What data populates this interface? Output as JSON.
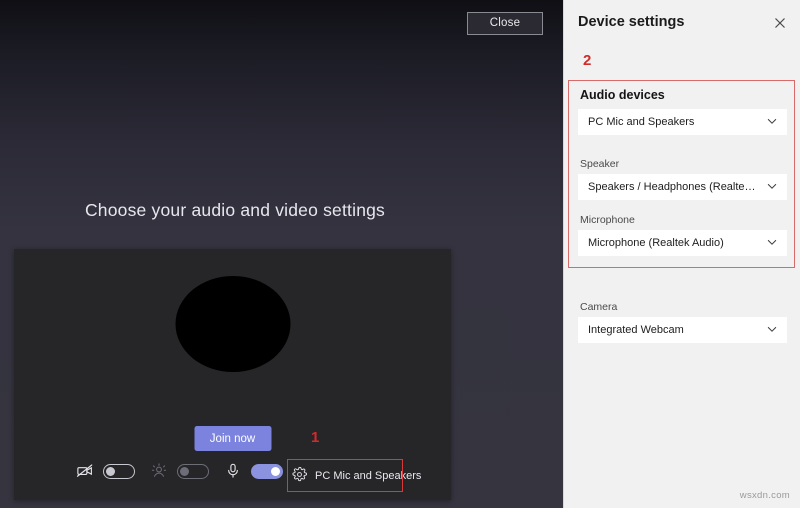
{
  "main": {
    "close_button_label": "Close",
    "heading": "Choose your audio and video settings",
    "join_button_label": "Join now",
    "device_chip_label": "PC Mic and Speakers",
    "controls": {
      "camera_icon": "camera-off-icon",
      "camera_toggle_state": "off",
      "background_blur_icon": "background-blur-icon",
      "background_blur_toggle_state": "off",
      "mic_icon": "microphone-icon",
      "mic_toggle_state": "on",
      "settings_icon": "gear-icon"
    }
  },
  "annotations": [
    {
      "label": "1",
      "target": "device-settings-chip",
      "color": "#d12b2b"
    },
    {
      "label": "2",
      "target": "audio-devices-section",
      "color": "#d12b2b"
    }
  ],
  "panel": {
    "title": "Device settings",
    "close_icon": "close-icon",
    "fields": [
      {
        "label": "Audio devices",
        "value": "PC Mic and Speakers",
        "chevron": "chevron-down-icon"
      },
      {
        "label": "Speaker",
        "value": "Speakers / Headphones (Realtek Aud...",
        "chevron": "chevron-down-icon"
      },
      {
        "label": "Microphone",
        "value": "Microphone (Realtek Audio)",
        "chevron": "chevron-down-icon"
      },
      {
        "label": "Camera",
        "value": "Integrated Webcam",
        "chevron": "chevron-down-icon"
      }
    ]
  },
  "watermark": "wsxdn.com",
  "colors": {
    "accent": "#7b83de",
    "annotation_red": "#d12b2b",
    "panel_bg": "#f1f1f1",
    "stage_bg": "#35343f",
    "preview_bg": "#262528"
  }
}
